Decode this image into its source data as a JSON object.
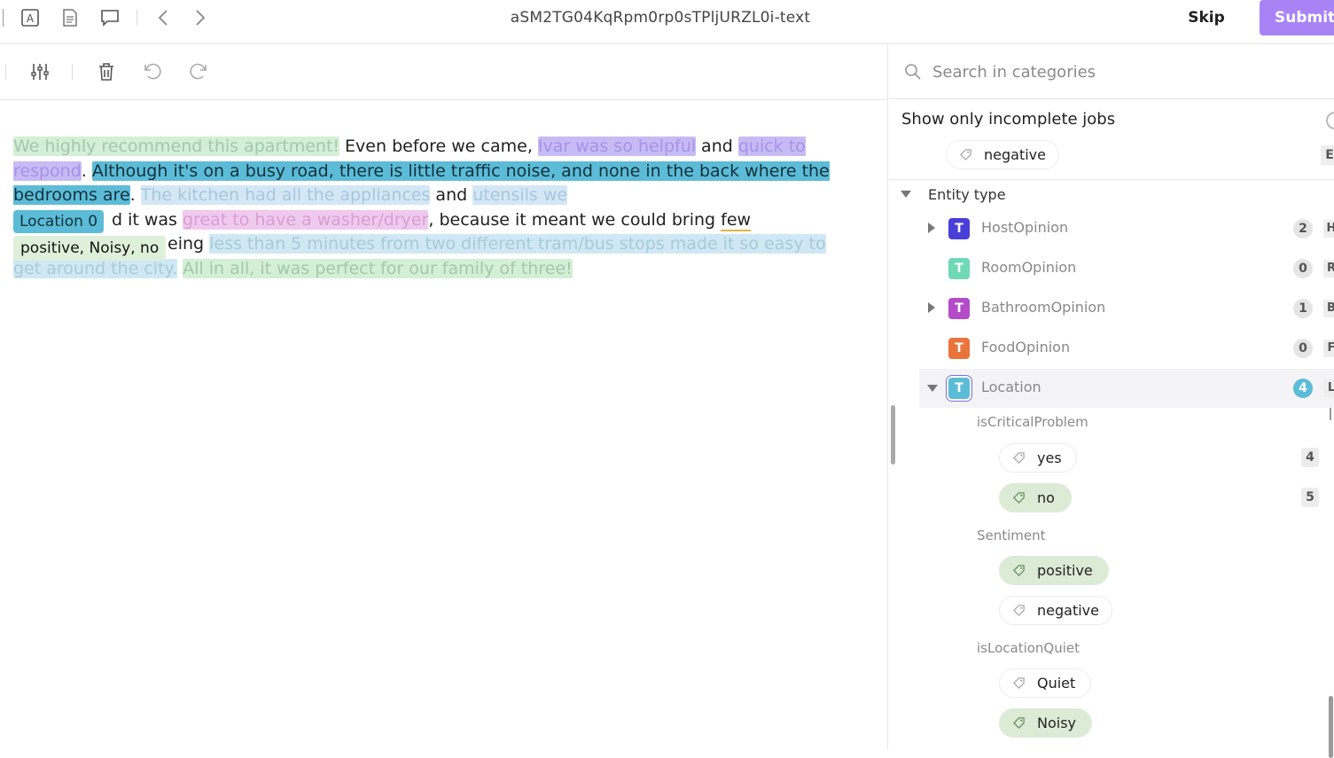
{
  "header": {
    "title": "aSM2TG04KqRpm0rp0sTPljURZL0i-text",
    "skip_label": "Skip",
    "submit_label": "Submit",
    "icons": [
      "text-mode-icon",
      "document-icon",
      "comment-icon",
      "chevron-left-icon",
      "chevron-right-icon"
    ]
  },
  "toolbar": {
    "icons": [
      "settings-sliders-icon",
      "delete-icon",
      "undo-icon",
      "redo-icon"
    ]
  },
  "editor": {
    "segments": [
      "We highly recommend this apartment!",
      " Even before we came, ",
      "Ivar was so helpful",
      " and ",
      "quick to respond",
      ". ",
      "Although it's on a busy road, there is little traffic noise, and none in the back where the bedrooms are",
      ". ",
      "The kitchen had all the appliances",
      " and ",
      "utensils we",
      "d it was ",
      "great to have a washer/dryer",
      ", because it meant we could bring ",
      "few",
      "eing ",
      "less than 5 minutes from two different ",
      "tram/bus stops",
      " made it so easy to get around the city.",
      " ",
      "All in all, it was perfect for our family of three!"
    ],
    "label_location": "Location 0",
    "label_attributes": "positive, Noisy, no"
  },
  "panel": {
    "search_placeholder": "Search in categories",
    "incomplete_label": "Show only incomplete jobs",
    "top_chip": "negative",
    "top_chip_key": "E",
    "entity_type_label": "Entity type",
    "entities": [
      {
        "name": "HostOpinion",
        "count": "2",
        "key": "H",
        "color": "#4a3fd8",
        "expandable": true
      },
      {
        "name": "RoomOpinion",
        "count": "0",
        "key": "R",
        "color": "#6fd8b4",
        "expandable": false
      },
      {
        "name": "BathroomOpinion",
        "count": "1",
        "key": "B",
        "color": "#b44bc9",
        "expandable": true
      },
      {
        "name": "FoodOpinion",
        "count": "0",
        "key": "F",
        "color": "#e9743c",
        "expandable": false
      },
      {
        "name": "Location",
        "count": "4",
        "key": "L",
        "color": "#5cbcd8",
        "expandable": true
      }
    ],
    "groups": {
      "critical": {
        "label": "isCriticalProblem",
        "yes": "yes",
        "yes_count": "4",
        "no": "no",
        "no_count": "5"
      },
      "sentiment": {
        "label": "Sentiment",
        "positive": "positive",
        "negative": "negative"
      },
      "quiet": {
        "label": "isLocationQuiet",
        "quiet": "Quiet",
        "noisy": "Noisy"
      }
    }
  }
}
